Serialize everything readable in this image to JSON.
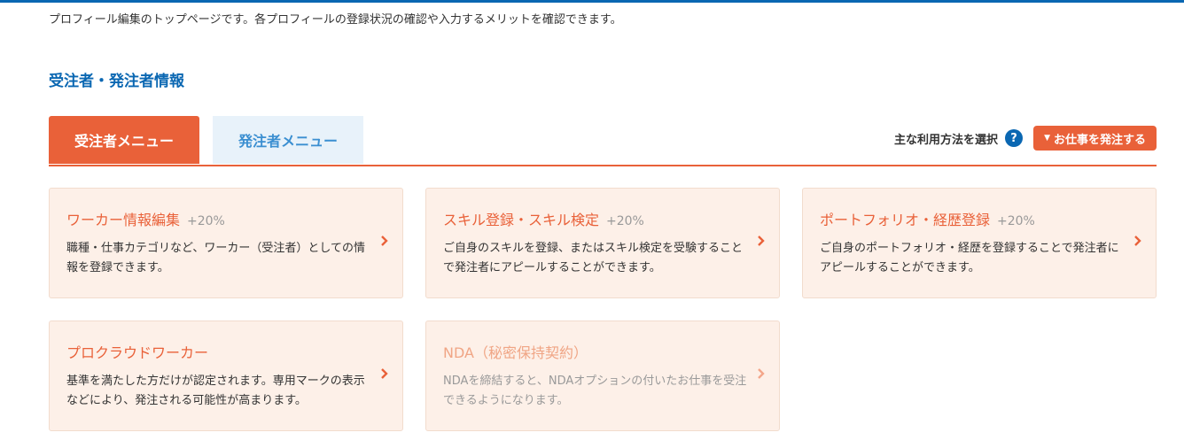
{
  "intro_text": "プロフィール編集のトップページです。各プロフィールの登録状況の確認や入力するメリットを確認できます。",
  "section_title": "受注者・発注者情報",
  "tabs": [
    {
      "label": "受注者メニュー",
      "active": true
    },
    {
      "label": "発注者メニュー",
      "active": false
    }
  ],
  "mode_select": {
    "label": "主な利用方法を選択",
    "help_icon": "question-circle-icon",
    "button_label": "お仕事を発注する",
    "button_icon": "caret-down-icon"
  },
  "cards": [
    {
      "title": "ワーカー情報編集",
      "bonus": "+20%",
      "description": "職種・仕事カテゴリなど、ワーカー（受注者）としての情報を登録できます。",
      "disabled": false
    },
    {
      "title": "スキル登録・スキル検定",
      "bonus": "+20%",
      "description": "ご自身のスキルを登録、またはスキル検定を受験することで発注者にアピールすることができます。",
      "disabled": false
    },
    {
      "title": "ポートフォリオ・経歴登録",
      "bonus": "+20%",
      "description": "ご自身のポートフォリオ・経歴を登録することで発注者にアピールすることができます。",
      "disabled": false
    },
    {
      "title": "プロクラウドワーカー",
      "bonus": "",
      "description": "基準を満たした方だけが認定されます。専用マークの表示などにより、発注される可能性が高まります。",
      "disabled": false
    },
    {
      "title": "NDA（秘密保持契約）",
      "bonus": "",
      "description": "NDAを締結すると、NDAオプションの付いたお仕事を受注できるようになります。",
      "disabled": true
    }
  ],
  "colors": {
    "accent": "#e96139",
    "brand_blue": "#0a67b2",
    "card_bg": "#fdf0e8",
    "tab_inactive_bg": "#e8f2fa"
  }
}
